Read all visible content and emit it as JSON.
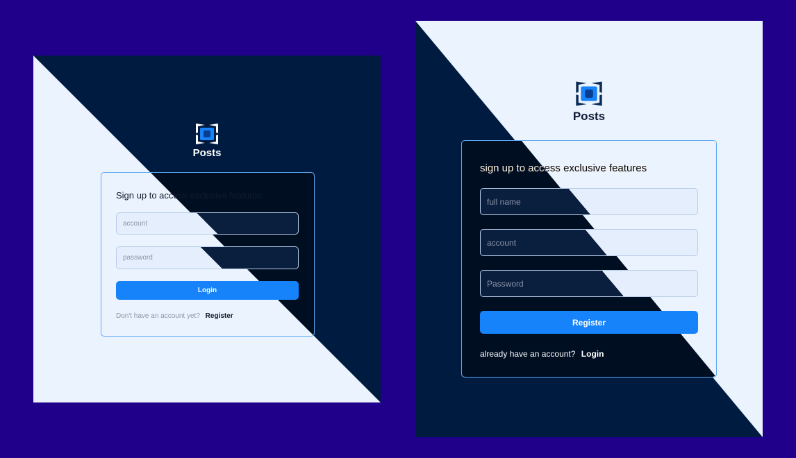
{
  "brand": {
    "name": "Posts",
    "logo_icon": "posts-logo-icon"
  },
  "colors": {
    "page_bg": "#20008a",
    "light": "#ebf3fe",
    "dark": "#001b40",
    "card_border": "#5ea9f5",
    "accent": "#1683fb"
  },
  "login": {
    "heading": "Sign up to access exclusive features",
    "account_placeholder": "account",
    "password_placeholder": "password",
    "submit_label": "Login",
    "footer_text": "Don't have an account yet?",
    "footer_link": "Register"
  },
  "register": {
    "heading": "sign up to access exclusive features",
    "fullname_placeholder": "full name",
    "account_placeholder": "account",
    "password_placeholder": "Password",
    "submit_label": "Register",
    "footer_text": "already have an account?",
    "footer_link": "Login"
  }
}
